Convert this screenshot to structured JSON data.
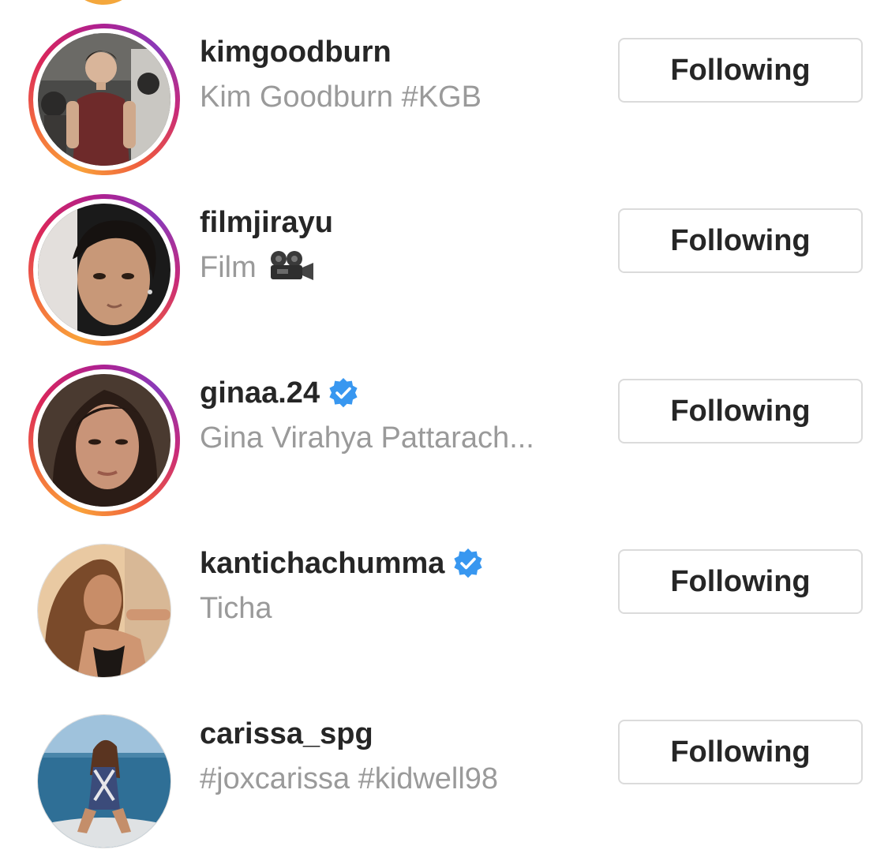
{
  "following_list": [
    {
      "username": "kimgoodburn",
      "full_name": "Kim Goodburn #KGB",
      "verified": false,
      "has_story_ring": true,
      "button_label": "Following"
    },
    {
      "username": "filmjirayu",
      "full_name": "Film",
      "full_name_icon": "movie-camera-emoji",
      "verified": false,
      "has_story_ring": true,
      "button_label": "Following"
    },
    {
      "username": "ginaa.24",
      "full_name": "Gina Virahya Pattarach...",
      "verified": true,
      "has_story_ring": true,
      "button_label": "Following"
    },
    {
      "username": "kantichachumma",
      "full_name": "Ticha",
      "verified": true,
      "has_story_ring": false,
      "button_label": "Following"
    },
    {
      "username": "carissa_spg",
      "full_name": "#joxcarissa #kidwell98",
      "verified": false,
      "has_story_ring": false,
      "button_label": "Following"
    }
  ],
  "colors": {
    "username_text": "#262626",
    "secondary_text": "#9a9a9a",
    "button_border": "#dbdbdb",
    "verified_badge": "#3897f0",
    "story_ring_start": "#f9a23a",
    "story_ring_end": "#8a3ab9"
  }
}
